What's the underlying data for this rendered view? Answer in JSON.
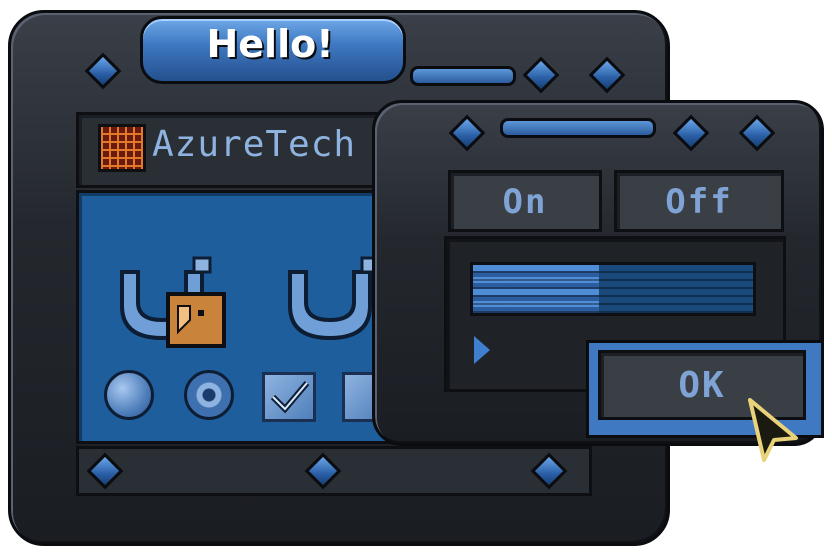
{
  "back_window": {
    "title": "Hello!",
    "brand": {
      "name": "AzureTech",
      "icon": "grid-logo-icon"
    },
    "icons": [
      "magnet-lock-icon",
      "magnet-icon"
    ],
    "controls": [
      "radio-button-icon",
      "radio-button-selected-icon",
      "checkbox-checked-icon",
      "checkbox-icon"
    ]
  },
  "front_window": {
    "toggle_on_label": "On",
    "toggle_off_label": "Off",
    "progress": 0.45,
    "ok_label": "OK"
  },
  "colors": {
    "accent": "#3f79c2",
    "panel_blue": "#1e5e9c",
    "frame_dark": "#24282e",
    "text_blue": "#7ea3d4"
  }
}
